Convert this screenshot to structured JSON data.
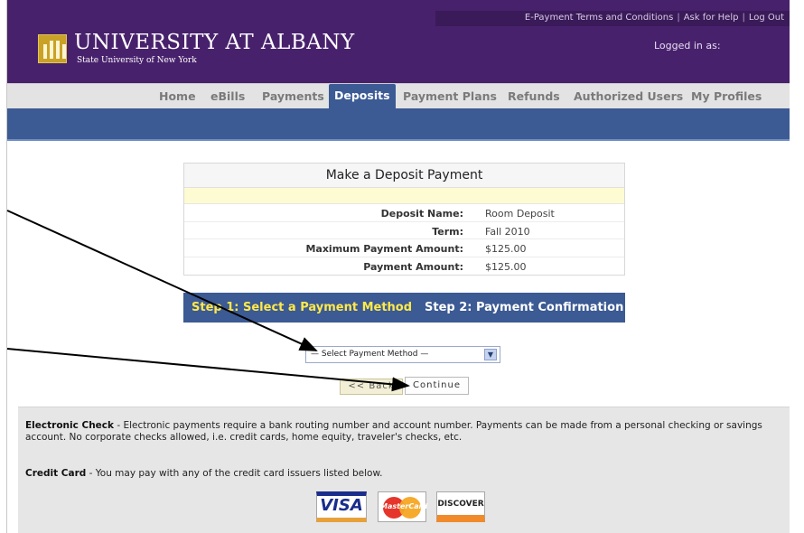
{
  "header": {
    "top_links": [
      "E-Payment Terms and Conditions",
      "Ask for Help",
      "Log Out"
    ],
    "logo_main": "UNIVERSITY AT ALBANY",
    "logo_sub": "State University of New York",
    "logged_in": "Logged in as:",
    "brand_color": "#48216c"
  },
  "nav": {
    "tabs": [
      {
        "label": "Home"
      },
      {
        "label": "eBills"
      },
      {
        "label": "Payments"
      },
      {
        "label": "Deposits"
      },
      {
        "label": "Payment Plans"
      },
      {
        "label": "Refunds"
      },
      {
        "label": "Authorized Users"
      },
      {
        "label": "My Profiles"
      }
    ],
    "active": "Deposits",
    "accent_color": "#3c5a93"
  },
  "deposit": {
    "title": "Make a Deposit Payment",
    "rows": [
      {
        "label": "Deposit Name:",
        "value": "Room Deposit"
      },
      {
        "label": "Term:",
        "value": "Fall 2010"
      },
      {
        "label": "Maximum Payment Amount:",
        "value": "$125.00"
      },
      {
        "label": "Payment Amount:",
        "value": "$125.00"
      }
    ]
  },
  "steps": {
    "step1": "Step 1: Select a Payment Method",
    "step2": "Step 2: Payment Confirmation",
    "step1_color": "#ffe94a"
  },
  "form": {
    "select_value": "— Select Payment Method —",
    "back_label": "<< Back",
    "continue_label": "Continue"
  },
  "info": {
    "echeck_title": "Electronic Check",
    "echeck_text": " - Electronic payments require a bank routing number and account number. Payments can be made from a personal checking or savings account. No corporate checks allowed, i.e. credit cards, home equity, traveler's checks, etc.",
    "cc_title": "Credit Card",
    "cc_text": " - You may pay with any of the credit card issuers listed below.",
    "cards": [
      "VISA",
      "MasterCard",
      "DISCOVER"
    ]
  }
}
